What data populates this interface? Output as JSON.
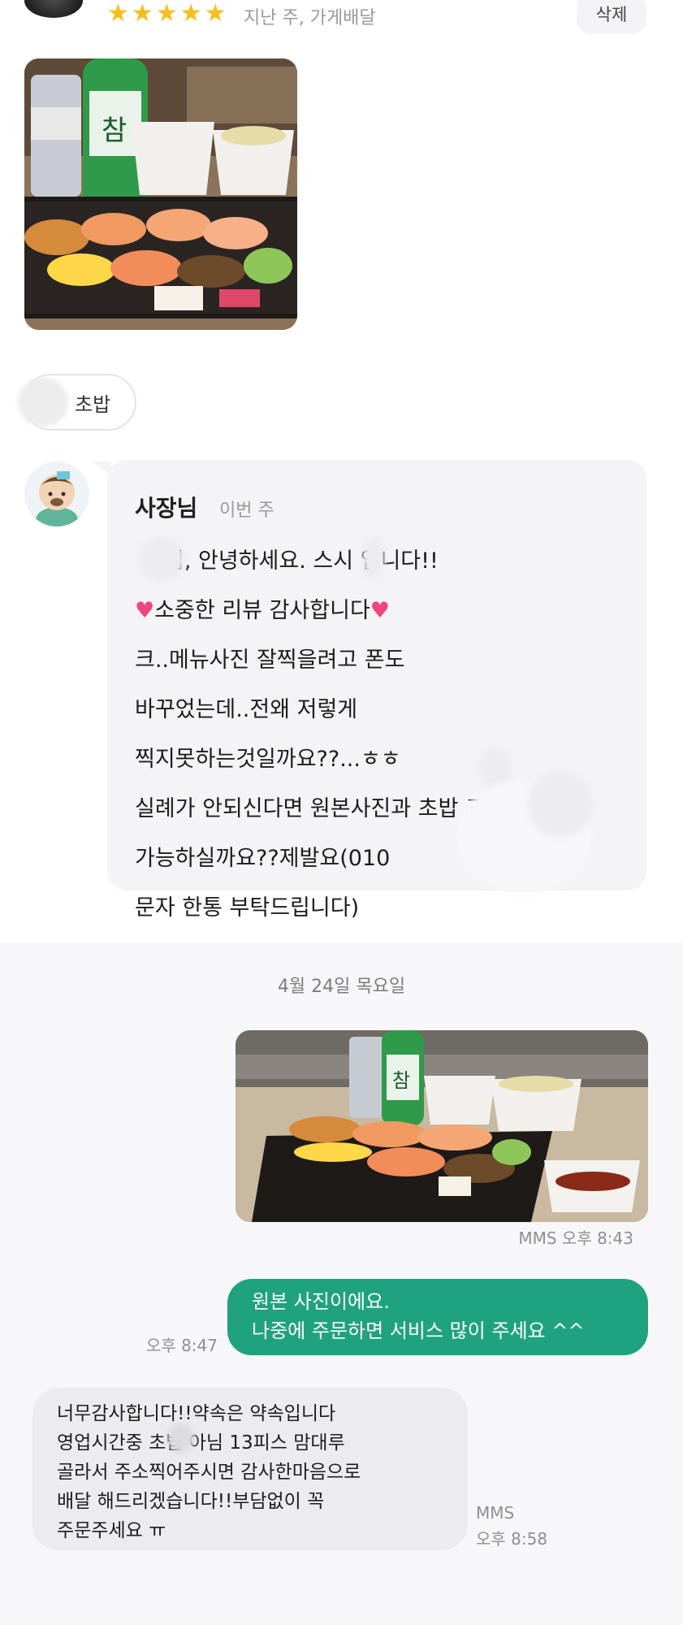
{
  "review": {
    "rating_stars": 5,
    "meta": "지난 주, 가게배달",
    "delete_label": "삭제",
    "menu_chip": "초밥"
  },
  "owner_reply": {
    "name": "사장님",
    "when": "이번 주",
    "lines": [
      "님, 안녕하세요.   스시 입니다!!",
      "소중한 리뷰 감사합니다",
      "크..메뉴사진 잘찍을려고 폰도",
      "바꾸었는데..전왜 저렇게",
      "찍지못하는것일까요??...ㅎㅎ",
      "실례가 안되신다면 원본사진과    초밥 교환",
      "가능하실까요??제발요(010",
      "문자 한통 부탁드립니다)"
    ]
  },
  "messages": {
    "date": "4월 24일 목요일",
    "photo_time": "MMS 오후 8:43",
    "sent_lines": [
      "원본 사진이에요.",
      "나중에 주문하면 서비스 많이 주세요 ^^"
    ],
    "sent_time": "오후 8:47",
    "received_lines": [
      "너무감사합니다!!약속은 약속입니다",
      "영업시간중    초밥 아님 13피스 맘대루",
      "골라서 주소찍어주시면 감사한마음으로",
      "배달 해드리겠습니다!!부담없이 꼭",
      "주문주세요 ㅠ"
    ],
    "received_label": "MMS",
    "received_time": "오후 8:58"
  },
  "colors": {
    "star": "#f7bf1e",
    "heart": "#f0457e",
    "sent_bubble": "#1fa37e",
    "received_bubble": "#ececef"
  }
}
